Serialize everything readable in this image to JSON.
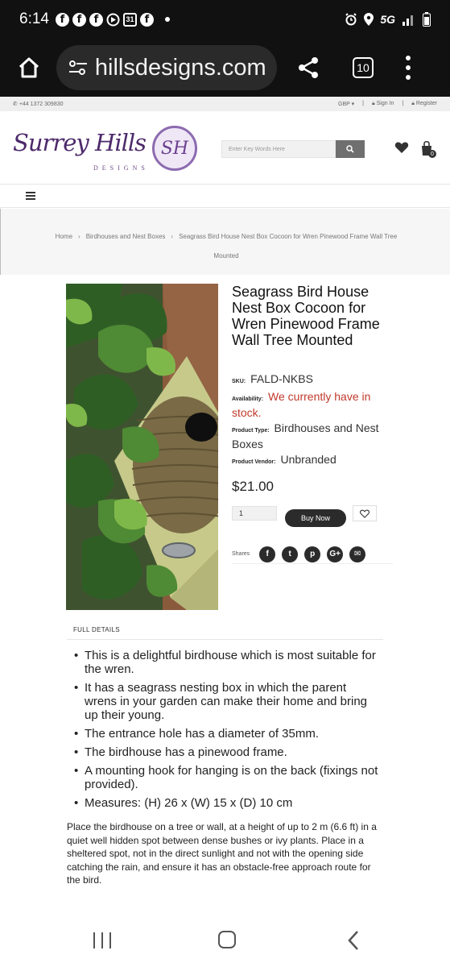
{
  "status_bar": {
    "time": "6:14",
    "calendar_day": "31",
    "network": "5G"
  },
  "browser": {
    "url": "hillsdesigns.com",
    "tab_count": "10"
  },
  "top_info": {
    "phone": "+44 1372 309830",
    "currency": "GBP",
    "sign_in": "Sign In",
    "register": "Register"
  },
  "header": {
    "logo_script": "Surrey Hills",
    "logo_sub": "DESIGNS",
    "logo_monogram": "SH",
    "search_placeholder": "Enter Key Words Here",
    "cart_count": "0"
  },
  "breadcrumb": {
    "home": "Home",
    "category": "Birdhouses and Nest Boxes",
    "current": "Seagrass Bird House Nest Box Cocoon for Wren Pinewood Frame Wall Tree Mounted"
  },
  "product": {
    "title": "Seagrass Bird House Nest Box Cocoon for Wren Pinewood Frame Wall Tree Mounted",
    "sku_label": "SKU:",
    "sku": "FALD-NKBS",
    "availability_label": "Availability:",
    "availability": "We currently have in stock.",
    "type_label": "Product Type:",
    "type": "Birdhouses and Nest Boxes",
    "vendor_label": "Product Vendor:",
    "vendor": "Unbranded",
    "price": "$21.00",
    "quantity": "1",
    "buy_now": "Buy Now",
    "shares_label": "Shares"
  },
  "details": {
    "heading": "FULL DETAILS",
    "bullets": [
      "This is a delightful birdhouse which is most suitable for the wren.",
      "It has a seagrass nesting box in which the parent wrens in your garden can make their home and bring up their young.",
      "The entrance hole has a diameter of 35mm.",
      "The birdhouse has a pinewood frame.",
      "A mounting hook for hanging is on the back (fixings not provided).",
      "Measures: (H) 26 x (W) 15 x (D) 10 cm"
    ],
    "description": "Place the birdhouse on a tree or wall, at a height of up to 2 m (6.6 ft) in a quiet well hidden spot between dense bushes or ivy plants. Place in a sheltered spot, not in the direct sunlight and not with the opening side catching the rain, and ensure it has an obstacle-free approach route for the bird."
  },
  "colors": {
    "brand_purple": "#4d2a6b",
    "stock_red": "#c0392b",
    "dark_button": "#2b2b2b"
  }
}
